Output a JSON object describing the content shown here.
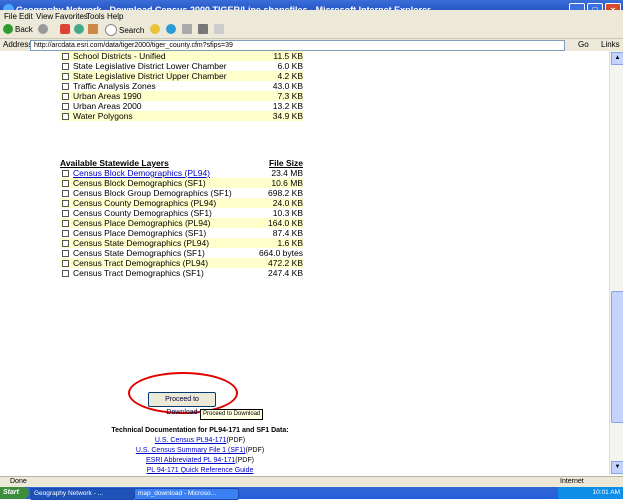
{
  "window": {
    "title": "Geography Network - Download Census 2000 TIGER/Line shapefiles - Microsoft Internet Explorer"
  },
  "menu": [
    "File",
    "Edit",
    "View",
    "Favorites",
    "Tools",
    "Help"
  ],
  "toolbar": {
    "back": "Back",
    "search": "Search"
  },
  "address": {
    "label": "Address",
    "url": "http://arcdata.esri.com/data/tiger2000/tiger_county.cfm?sfips=39",
    "go": "Go",
    "links": "Links"
  },
  "county_layers": [
    {
      "name": "School Districts - Unified",
      "size": "11.5 KB"
    },
    {
      "name": "State Legislative District Lower Chamber",
      "size": "6.0 KB"
    },
    {
      "name": "State Legislative District Upper Chamber",
      "size": "4.2 KB"
    },
    {
      "name": "Traffic Analysis Zones",
      "size": "43.0 KB"
    },
    {
      "name": "Urban Areas 1990",
      "size": "7.3 KB"
    },
    {
      "name": "Urban Areas 2000",
      "size": "13.2 KB"
    },
    {
      "name": "Water Polygons",
      "size": "34.9 KB"
    }
  ],
  "statewide": {
    "header_name": "Available Statewide Layers",
    "header_size": "File Size",
    "rows": [
      {
        "name": "Census Block Demographics (PL94)",
        "size": "23.4 MB"
      },
      {
        "name": "Census Block Demographics (SF1)",
        "size": "10.6 MB"
      },
      {
        "name": "Census Block Group Demographics (SF1)",
        "size": "698.2 KB"
      },
      {
        "name": "Census County Demographics (PL94)",
        "size": "24.0 KB"
      },
      {
        "name": "Census County Demographics (SF1)",
        "size": "10.3 KB"
      },
      {
        "name": "Census Place Demographics (PL94)",
        "size": "164.0 KB"
      },
      {
        "name": "Census Place Demographics (SF1)",
        "size": "87.4 KB"
      },
      {
        "name": "Census State Demographics (PL94)",
        "size": "1.6 KB"
      },
      {
        "name": "Census State Demographics (SF1)",
        "size": "664.0 bytes"
      },
      {
        "name": "Census Tract Demographics (PL94)",
        "size": "472.2 KB"
      },
      {
        "name": "Census Tract Demographics (SF1)",
        "size": "247.4 KB"
      }
    ]
  },
  "proceed": {
    "label": "Proceed to Download",
    "tooltip": "Proceed to Download"
  },
  "docs": {
    "title": "Technical Documentation for PL94-171 and SF1 Data:",
    "l1": "U.S. Census PL94-171",
    "l1_suffix": "(PDF)",
    "l2": "U.S. Census Summary File 1 (SF1)",
    "l2_suffix": "(PDF)",
    "l3": "ESRI Abbreviated PL 94-171",
    "l3_suffix": "(PDF)",
    "l4": "PL 94-171 Quick Reference Guide"
  },
  "status": {
    "text": "Done",
    "zone": "Internet"
  },
  "taskbar": {
    "start": "Start",
    "task1": "Geography Network - ...",
    "task2": "map_download - Microso...",
    "clock": "10:01 AM"
  }
}
